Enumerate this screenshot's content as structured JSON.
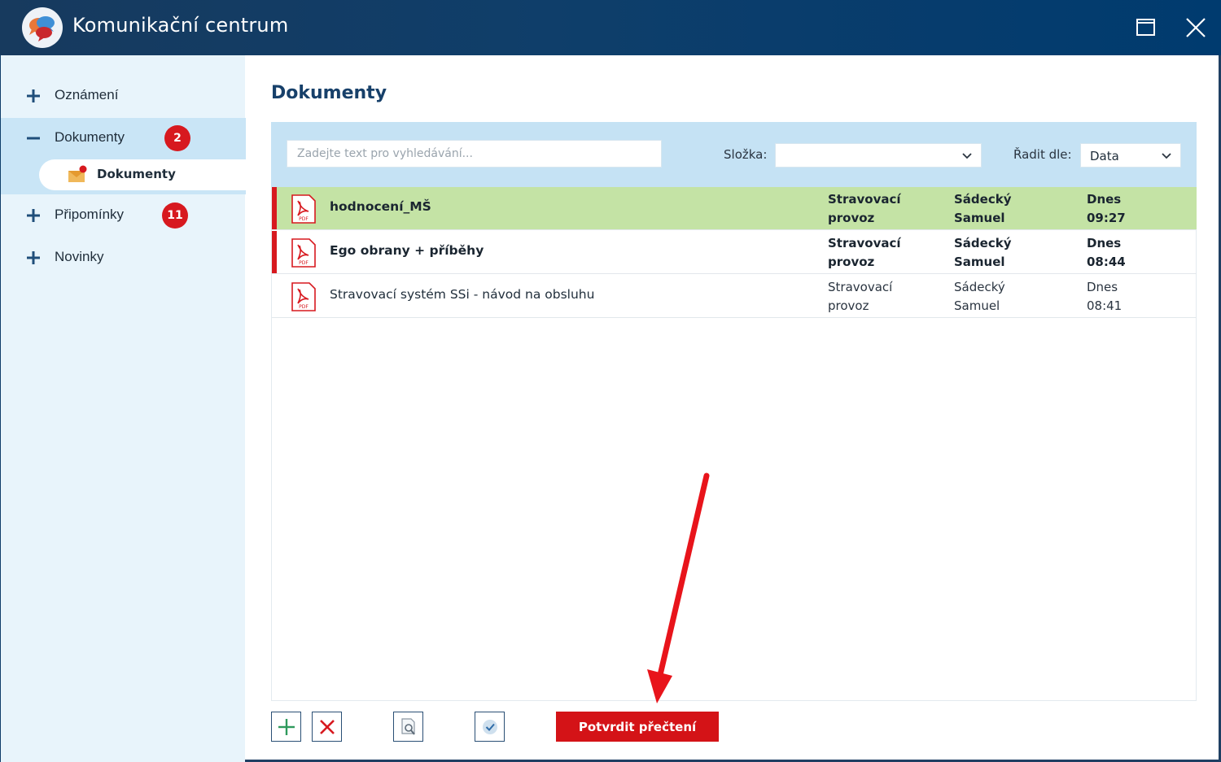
{
  "window": {
    "title": "Komunikační centrum",
    "maximize_icon": "maximize-icon",
    "close_icon": "close-icon"
  },
  "sidebar": {
    "items": [
      {
        "label": "Oznámení",
        "sign": "plus",
        "badge": null
      },
      {
        "label": "Dokumenty",
        "sign": "minus",
        "badge": "2",
        "expanded": true
      },
      {
        "label": "Připomínky",
        "sign": "plus",
        "badge": "11"
      },
      {
        "label": "Novinky",
        "sign": "plus",
        "badge": null
      }
    ],
    "sub_item": {
      "label": "Dokumenty",
      "icon": "envelope-icon",
      "selected": true
    }
  },
  "main": {
    "title": "Dokumenty",
    "search": {
      "placeholder": "Zadejte text pro vyhledávání...",
      "value": ""
    },
    "folder": {
      "label": "Složka:",
      "value": ""
    },
    "sort": {
      "label": "Řadit dle:",
      "value": "Data"
    }
  },
  "documents": [
    {
      "title": "hodnocení_MŠ",
      "folder_1": "Stravovací",
      "folder_2": "provoz",
      "author_1": "Sádecký",
      "author_2": "Samuel",
      "date_1": "Dnes",
      "date_2": "09:27",
      "unread": true,
      "selected": true,
      "icon": "pdf-icon"
    },
    {
      "title": "Ego obrany + příběhy",
      "folder_1": "Stravovací",
      "folder_2": "provoz",
      "author_1": "Sádecký",
      "author_2": "Samuel",
      "date_1": "Dnes",
      "date_2": "08:44",
      "unread": true,
      "selected": false,
      "icon": "pdf-icon"
    },
    {
      "title": "Stravovací systém SSi - návod na obsluhu",
      "folder_1": "Stravovací",
      "folder_2": "provoz",
      "author_1": "Sádecký",
      "author_2": "Samuel",
      "date_1": "Dnes",
      "date_2": "08:41",
      "unread": false,
      "selected": false,
      "icon": "pdf-icon"
    }
  ],
  "toolbar": {
    "add_icon": "plus-icon",
    "delete_icon": "x-icon",
    "preview_icon": "document-search-icon",
    "mark_icon": "check-circle-icon",
    "confirm_label": "Potvrdit přečtení"
  },
  "colors": {
    "titlebar": "#0f3e6a",
    "sidebar_bg": "#e8f4fb",
    "sidebar_active": "#c9e5f6",
    "selected_row": "#c4e3a5",
    "unread_marker": "#d7191f",
    "confirm_button": "#d41317",
    "annotation_arrow": "#e8141b"
  }
}
